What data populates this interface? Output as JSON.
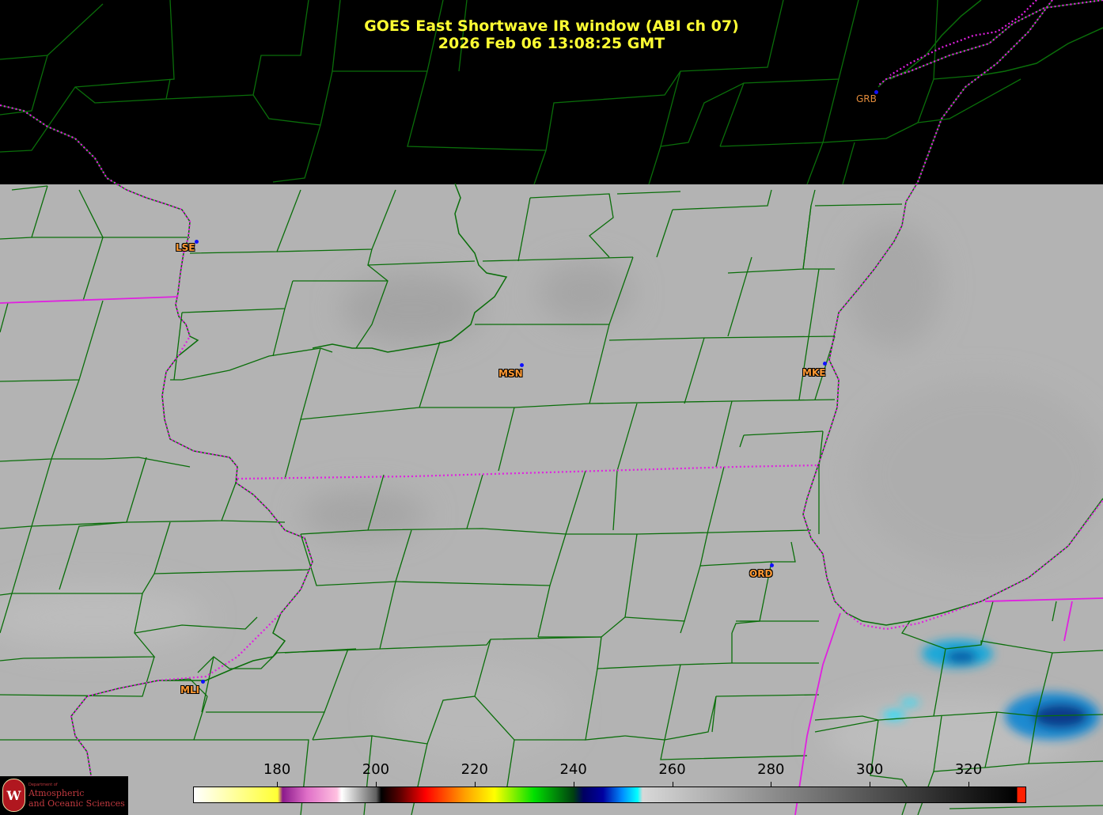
{
  "title": {
    "line1": "GOES East Shortwave IR window (ABI ch 07)",
    "line2": "2026 Feb 06  13:08:25 GMT"
  },
  "cities": [
    {
      "code": "GRB"
    },
    {
      "code": "LSE"
    },
    {
      "code": "MSN"
    },
    {
      "code": "MKE"
    },
    {
      "code": "ORD"
    },
    {
      "code": "MLI"
    }
  ],
  "colorbar": {
    "unit_min": 163,
    "unit_max": 330,
    "ticks": [
      "180",
      "200",
      "220",
      "240",
      "260",
      "280",
      "300",
      "320"
    ],
    "stops": [
      {
        "t": 163,
        "c": "#ffffff"
      },
      {
        "t": 180,
        "c": "#ffff33"
      },
      {
        "t": 181,
        "c": "#8b1a8b"
      },
      {
        "t": 186,
        "c": "#e070c8"
      },
      {
        "t": 192,
        "c": "#ffc0e0"
      },
      {
        "t": 193,
        "c": "#ffffff"
      },
      {
        "t": 200,
        "c": "#606060"
      },
      {
        "t": 201,
        "c": "#000000"
      },
      {
        "t": 205,
        "c": "#600000"
      },
      {
        "t": 210,
        "c": "#ff0000"
      },
      {
        "t": 218,
        "c": "#ffa000"
      },
      {
        "t": 224,
        "c": "#ffff00"
      },
      {
        "t": 232,
        "c": "#00e000"
      },
      {
        "t": 240,
        "c": "#004010"
      },
      {
        "t": 242,
        "c": "#000060"
      },
      {
        "t": 246,
        "c": "#0000a0"
      },
      {
        "t": 250,
        "c": "#0090ff"
      },
      {
        "t": 253,
        "c": "#00ffff"
      },
      {
        "t": 254,
        "c": "#d8d8d8"
      },
      {
        "t": 330,
        "c": "#000000"
      }
    ],
    "endcap_color": "#ff2000"
  },
  "logo": {
    "dept": "Department of",
    "line1": "Atmospheric",
    "line2": "and Oceanic Sciences",
    "seal_letter": "W"
  },
  "colors": {
    "county_lines": "#0a6e0a",
    "state_lines": "#e020e0",
    "title": "#ffff33",
    "city_label": "#ff9933"
  }
}
